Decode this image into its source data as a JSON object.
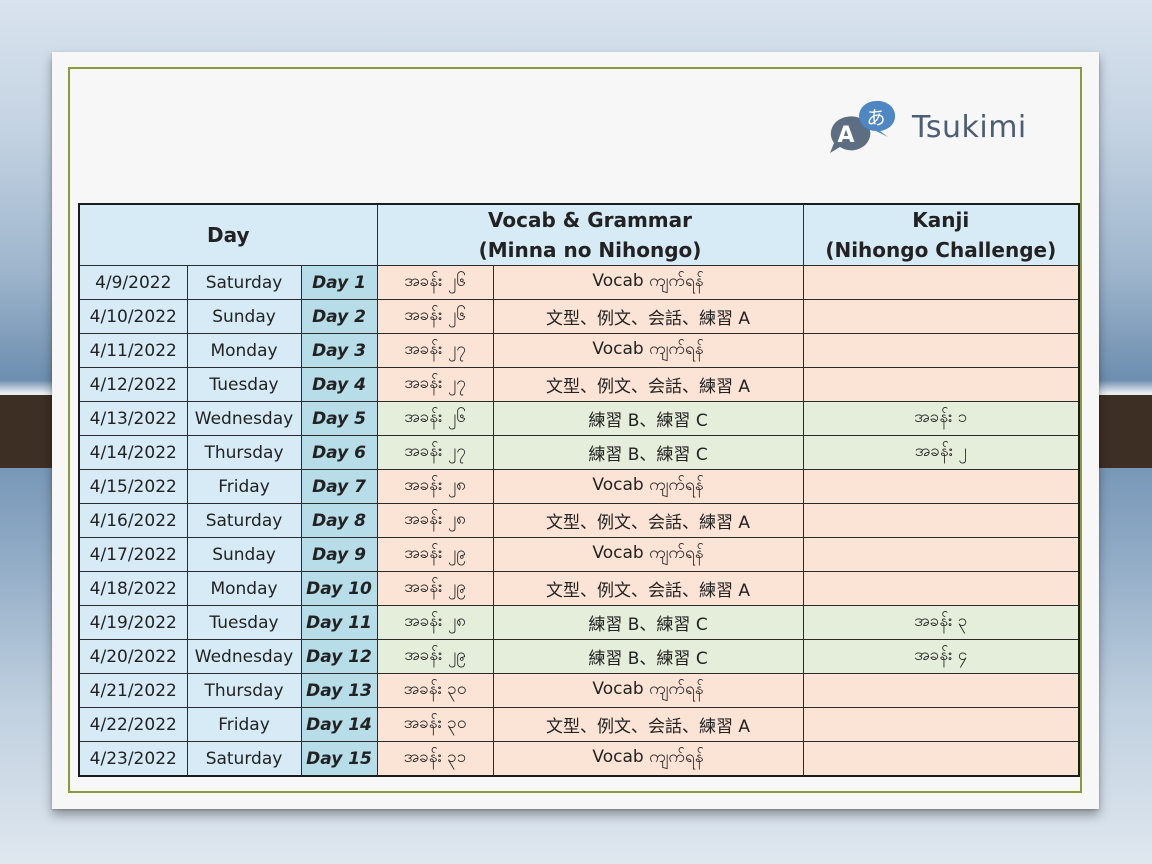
{
  "logo": {
    "text": "Tsukimi",
    "glyph_a": "A",
    "glyph_kana": "あ"
  },
  "header": {
    "day": "Day",
    "vocab_line1": "Vocab & Grammar",
    "vocab_line2": "(Minna no Nihongo)",
    "kanji_line1": "Kanji",
    "kanji_line2": "(Nihongo Challenge)"
  },
  "rows": [
    {
      "date": "4/9/2022",
      "weekday": "Saturday",
      "day": "Day 1",
      "lesson": "အခန်း ၂၆",
      "vocab": "Vocab ကျက်ရန်",
      "kanji": "",
      "shade": "peach"
    },
    {
      "date": "4/10/2022",
      "weekday": "Sunday",
      "day": "Day 2",
      "lesson": "အခန်း ၂၆",
      "vocab": "文型、例文、会話、練習 A",
      "kanji": "",
      "shade": "peach"
    },
    {
      "date": "4/11/2022",
      "weekday": "Monday",
      "day": "Day 3",
      "lesson": "အခန်း ၂၇",
      "vocab": "Vocab ကျက်ရန်",
      "kanji": "",
      "shade": "peach"
    },
    {
      "date": "4/12/2022",
      "weekday": "Tuesday",
      "day": "Day 4",
      "lesson": "အခန်း ၂၇",
      "vocab": "文型、例文、会話、練習 A",
      "kanji": "",
      "shade": "peach"
    },
    {
      "date": "4/13/2022",
      "weekday": "Wednesday",
      "day": "Day 5",
      "lesson": "အခန်း ၂၆",
      "vocab": "練習 B、練習 C",
      "kanji": "အခန်း ၁",
      "shade": "green"
    },
    {
      "date": "4/14/2022",
      "weekday": "Thursday",
      "day": "Day 6",
      "lesson": "အခန်း ၂၇",
      "vocab": "練習 B、練習 C",
      "kanji": "အခန်း ၂",
      "shade": "green"
    },
    {
      "date": "4/15/2022",
      "weekday": "Friday",
      "day": "Day 7",
      "lesson": "အခန်း ၂၈",
      "vocab": "Vocab ကျက်ရန်",
      "kanji": "",
      "shade": "peach"
    },
    {
      "date": "4/16/2022",
      "weekday": "Saturday",
      "day": "Day 8",
      "lesson": "အခန်း ၂၈",
      "vocab": "文型、例文、会話、練習 A",
      "kanji": "",
      "shade": "peach"
    },
    {
      "date": "4/17/2022",
      "weekday": "Sunday",
      "day": "Day 9",
      "lesson": "အခန်း ၂၉",
      "vocab": "Vocab ကျက်ရန်",
      "kanji": "",
      "shade": "peach"
    },
    {
      "date": "4/18/2022",
      "weekday": "Monday",
      "day": "Day 10",
      "lesson": "အခန်း ၂၉",
      "vocab": "文型、例文、会話、練習 A",
      "kanji": "",
      "shade": "peach"
    },
    {
      "date": "4/19/2022",
      "weekday": "Tuesday",
      "day": "Day 11",
      "lesson": "အခန်း ၂၈",
      "vocab": "練習 B、練習 C",
      "kanji": "အခန်း ၃",
      "shade": "green"
    },
    {
      "date": "4/20/2022",
      "weekday": "Wednesday",
      "day": "Day 12",
      "lesson": "အခန်း ၂၉",
      "vocab": "練習 B、練習 C",
      "kanji": "အခန်း ၄",
      "shade": "green"
    },
    {
      "date": "4/21/2022",
      "weekday": "Thursday",
      "day": "Day 13",
      "lesson": "အခန်း ၃၀",
      "vocab": "Vocab ကျက်ရန်",
      "kanji": "",
      "shade": "peach"
    },
    {
      "date": "4/22/2022",
      "weekday": "Friday",
      "day": "Day 14",
      "lesson": "အခန်း ၃၀",
      "vocab": "文型、例文、会話、練習 A",
      "kanji": "",
      "shade": "peach"
    },
    {
      "date": "4/23/2022",
      "weekday": "Saturday",
      "day": "Day 15",
      "lesson": "အခန်း ၃၁",
      "vocab": "Vocab ကျက်ရန်",
      "kanji": "",
      "shade": "peach"
    }
  ],
  "colors": {
    "header_bg": "#d6ebf5",
    "day_cell_bg": "#b7dde9",
    "peach_row": "#fbe3d5",
    "green_row": "#e5eedb",
    "frame_border": "#8a9a3c",
    "logo_color": "#4c5e74"
  }
}
